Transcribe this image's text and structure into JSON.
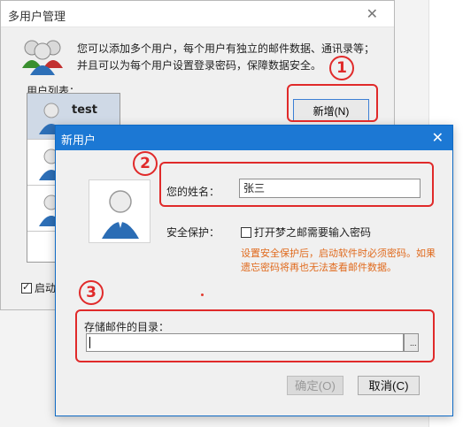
{
  "back_window": {
    "title": "多用户管理",
    "close_glyph": "✕",
    "intro": "您可以添加多个用户，每个用户有独立的邮件数据、通讯录等；并且可以为每个用户设置登录密码，保障数据安全。",
    "list_label": "用户列表：",
    "new_button": "新增(N)",
    "users": [
      {
        "name": "test",
        "selected": true
      },
      {
        "name": "",
        "selected": false
      },
      {
        "name": "",
        "selected": false
      },
      {
        "name": "",
        "selected": false
      }
    ],
    "startup_label": "启动时"
  },
  "dialog": {
    "title": "新用户",
    "close_glyph": "✕",
    "name_label": "您的姓名：",
    "name_value": "张三",
    "security_label": "安全保护：",
    "security_checkbox": "打开梦之邮需要输入密码",
    "security_checked": false,
    "security_hint": "设置安全保护后，启动软件时必须密码。如果遗忘密码将再也无法查看邮件数据。",
    "dir_label": "存储邮件的目录：",
    "dir_value": "",
    "browse_label": "...",
    "ok_button": "确定(O)",
    "cancel_button": "取消(C)"
  },
  "annotations": [
    "1",
    "2",
    "3"
  ],
  "colors": {
    "annotation": "#e02a2a",
    "dialog_title_bar": "#1c78d4",
    "hint_text": "#e06a1d",
    "selected_row": "#cfd9e6"
  }
}
